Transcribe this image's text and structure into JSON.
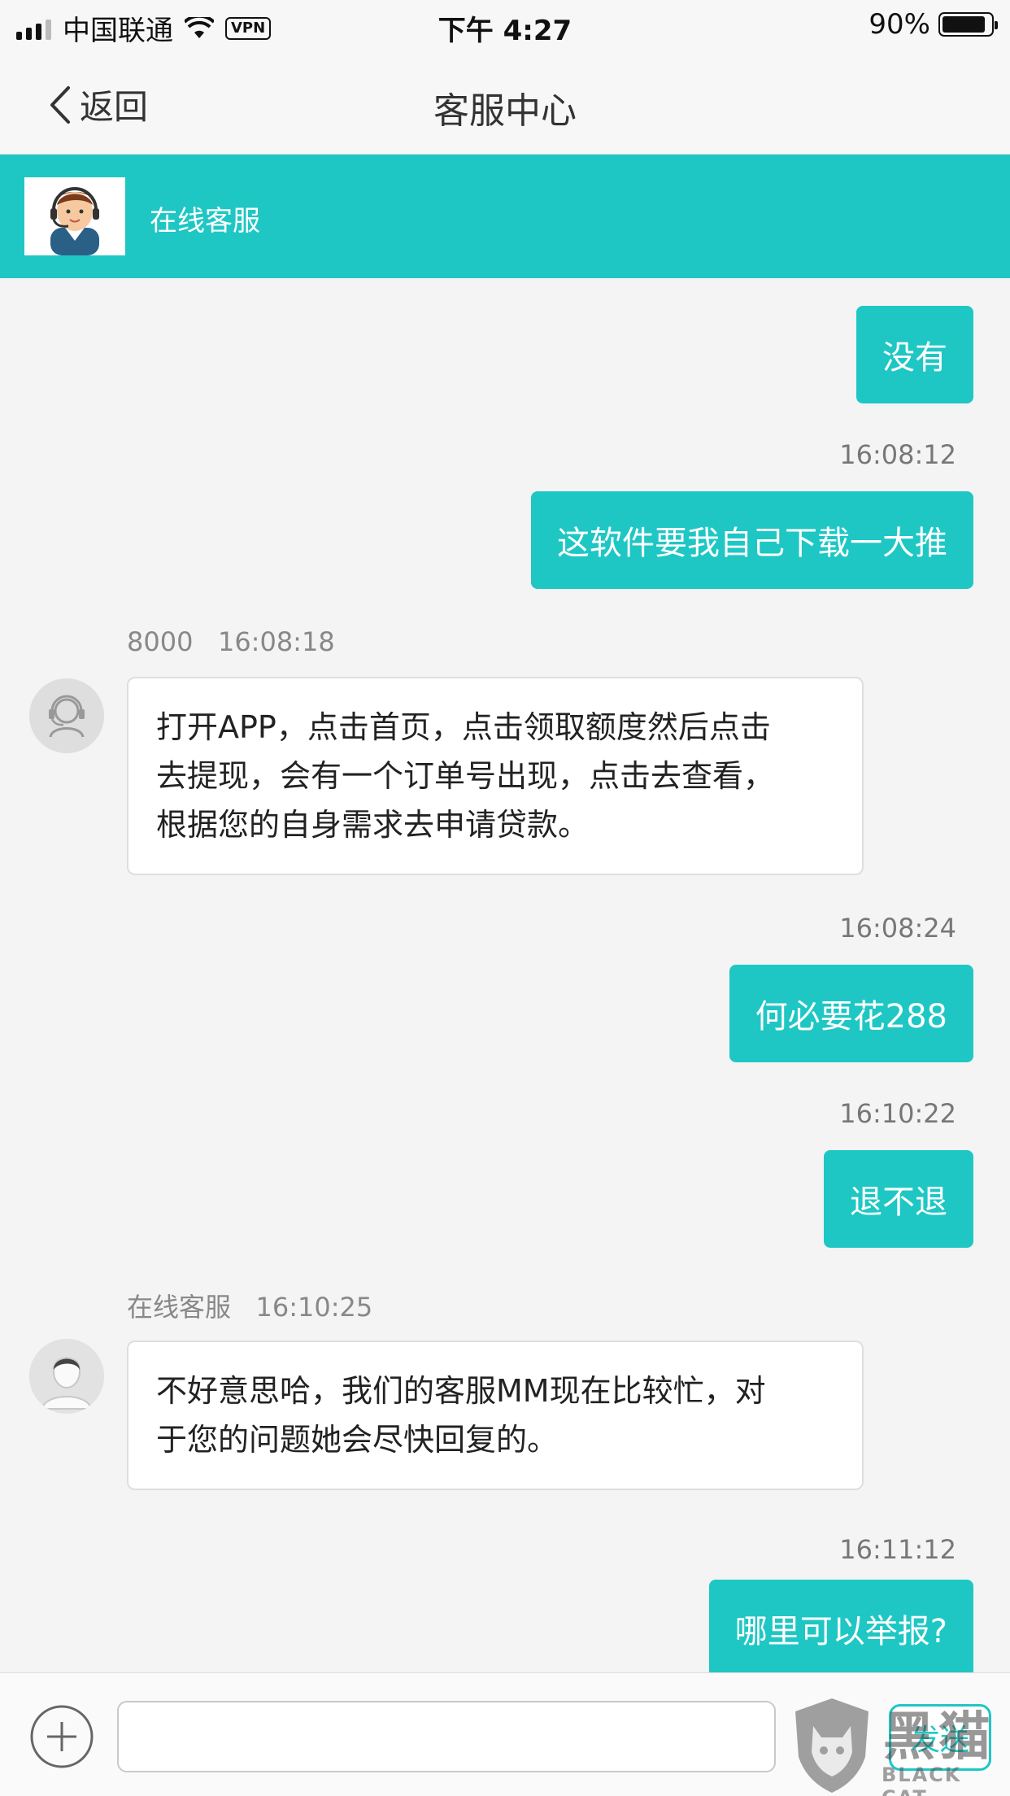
{
  "status_bar": {
    "carrier": "中国联通",
    "vpn": "VPN",
    "time": "下午 4:27",
    "battery": "90%",
    "battery_level": 0.9
  },
  "nav": {
    "back_label": "返回",
    "title": "客服中心"
  },
  "agent_header": {
    "name": "在线客服"
  },
  "messages": {
    "m1": {
      "text": "没有"
    },
    "m2": {
      "time": "16:08:12",
      "text": "这软件要我自己下载一大推"
    },
    "m3": {
      "sender": "8000",
      "time": "16:08:18",
      "lines": [
        "打开APP，点击首页，点击领取额度然后点击",
        "去提现，会有一个订单号出现，点击去查看，",
        "根据您的自身需求去申请贷款。"
      ]
    },
    "m4": {
      "time": "16:08:24",
      "text": "何必要花288"
    },
    "m5": {
      "time": "16:10:22",
      "text": "退不退"
    },
    "m6": {
      "sender": "在线客服",
      "time": "16:10:25",
      "lines": [
        "不好意思哈，我们的客服MM现在比较忙，对",
        "于您的问题她会尽快回复的。"
      ]
    },
    "m7": {
      "time": "16:11:12",
      "text": "哪里可以举报?"
    }
  },
  "input_bar": {
    "placeholder": "",
    "send_label": "发送"
  },
  "watermark": {
    "text_cn": "黑猫",
    "text_en": "BLACK CAT"
  },
  "colors": {
    "accent": "#1ec7c4",
    "background": "#f4f4f4"
  }
}
